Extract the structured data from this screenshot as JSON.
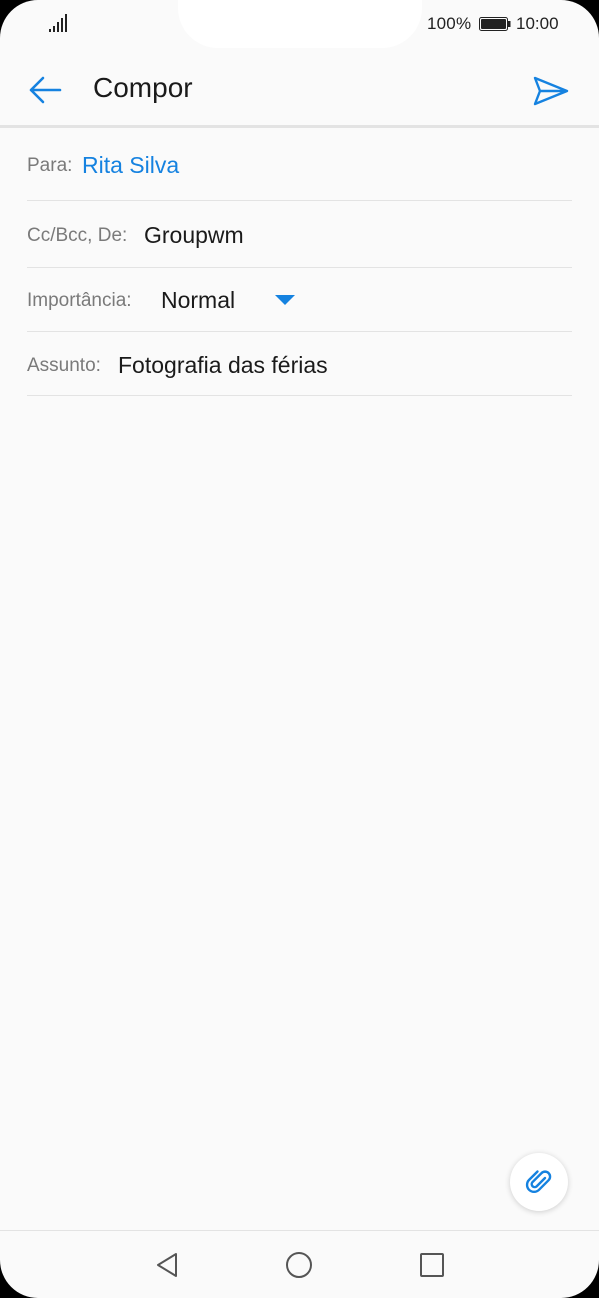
{
  "status_bar": {
    "battery_percent": "100%",
    "time": "10:00",
    "icons": [
      "signal-icon",
      "battery-icon"
    ]
  },
  "app_bar": {
    "title": "Compor",
    "back_icon": "arrow-left-icon",
    "send_icon": "send-icon"
  },
  "fields": {
    "to": {
      "label": "Para:",
      "value": "Rita Silva"
    },
    "cc_bcc_from": {
      "label": "Cc/Bcc, De:",
      "value": "Groupwm"
    },
    "importance": {
      "label": "Importância:",
      "value": "Normal"
    },
    "subject": {
      "label": "Assunto:",
      "value": "Fotografia das férias"
    }
  },
  "body": {
    "value": ""
  },
  "attach": {
    "icon": "paperclip-icon"
  },
  "nav_bar": {
    "icons": [
      "back-triangle-icon",
      "home-circle-icon",
      "recents-square-icon"
    ]
  },
  "colors": {
    "accent": "#1582e0",
    "background": "#fafafa",
    "divider": "#e3e3e3",
    "label": "#7a7a7a",
    "text": "#1a1a1a"
  }
}
